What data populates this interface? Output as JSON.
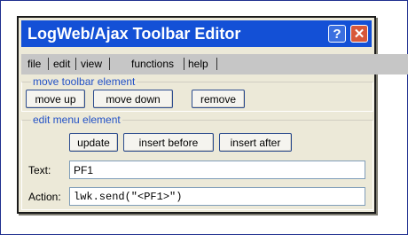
{
  "window": {
    "title": "LogWeb/Ajax Toolbar Editor",
    "help_glyph": "?",
    "close_glyph": "✕"
  },
  "menu": [
    "file",
    "edit",
    "view",
    "functions",
    "help"
  ],
  "move_group": {
    "legend": "move toolbar element",
    "buttons": [
      "move up",
      "move down",
      "remove"
    ]
  },
  "edit_group": {
    "legend": "edit menu element",
    "buttons": [
      "update",
      "insert before",
      "insert after"
    ],
    "text_label": "Text:",
    "text_value": "PF1",
    "action_label": "Action:",
    "action_value": "lwk.send(\"<PF1>\")"
  },
  "colors": {
    "titlebar": "#1350d6",
    "legend_text": "#2150c6",
    "window_bg": "#ece9d8",
    "close_button": "#d8583a"
  }
}
